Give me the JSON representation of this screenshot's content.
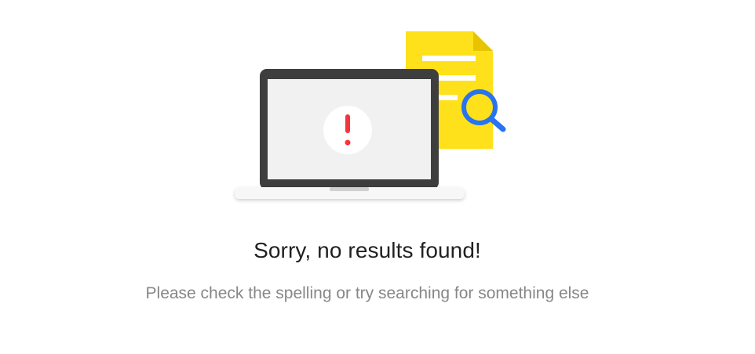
{
  "empty_state": {
    "title": "Sorry, no results found!",
    "message": "Please check the spelling or try searching for something else"
  },
  "colors": {
    "document": "#FFE11B",
    "document_fold": "#E8C400",
    "magnifier": "#2874F0",
    "laptop_frame": "#3E3E3E",
    "laptop_screen": "#F1F1F1",
    "alert": "#F4353B"
  },
  "icons": {
    "illustration": "no-results-illustration",
    "document": "document-icon",
    "magnifier": "magnifier-icon",
    "laptop": "laptop-icon",
    "alert": "exclamation-icon"
  }
}
